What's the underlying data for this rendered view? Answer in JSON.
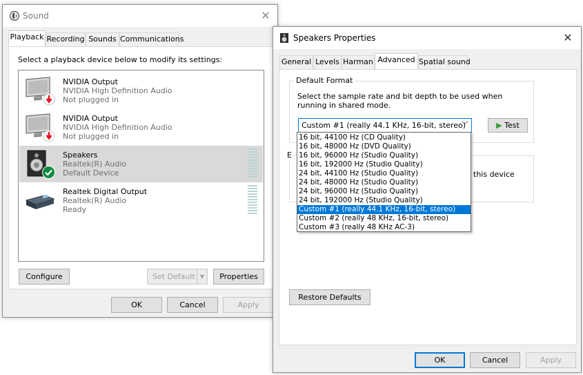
{
  "sound_window": {
    "title": "Sound",
    "tabs": [
      "Playback",
      "Recording",
      "Sounds",
      "Communications"
    ],
    "instruction": "Select a playback device below to modify its settings:",
    "devices": [
      {
        "name": "NVIDIA Output",
        "driver": "NVIDIA High Definition Audio",
        "status": "Not plugged in",
        "icon": "monitor-icon",
        "badge": "unplugged-arrow-icon"
      },
      {
        "name": "NVIDIA Output",
        "driver": "NVIDIA High Definition Audio",
        "status": "Not plugged in",
        "icon": "monitor-icon",
        "badge": "unplugged-arrow-icon"
      },
      {
        "name": "Speakers",
        "driver": "Realtek(R) Audio",
        "status": "Default Device",
        "icon": "speaker-icon",
        "badge": "default-check-icon",
        "selected": true
      },
      {
        "name": "Realtek Digital Output",
        "driver": "Realtek(R) Audio",
        "status": "Ready",
        "icon": "digital-output-icon"
      }
    ],
    "buttons": {
      "configure": "Configure",
      "set_default": "Set Default",
      "properties": "Properties",
      "ok": "OK",
      "cancel": "Cancel",
      "apply": "Apply"
    }
  },
  "props_window": {
    "title": "Speakers Properties",
    "tabs": [
      "General",
      "Levels",
      "Harman",
      "Advanced",
      "Spatial sound"
    ],
    "active_tab": "Advanced",
    "default_format": {
      "legend": "Default Format",
      "description": "Select the sample rate and bit depth to be used when running in shared mode.",
      "selected": "Custom #1 (really 44.1 KHz, 16-bit, stereo)",
      "test_label": "Test",
      "options": [
        "16 bit, 44100 Hz (CD Quality)",
        "16 bit, 48000 Hz (DVD Quality)",
        "16 bit, 96000 Hz (Studio Quality)",
        "16 bit, 192000 Hz (Studio Quality)",
        "24 bit, 44100 Hz (Studio Quality)",
        "24 bit, 48000 Hz (Studio Quality)",
        "24 bit, 96000 Hz (Studio Quality)",
        "24 bit, 192000 Hz (Studio Quality)",
        "Custom #1 (really 44.1 KHz, 16-bit, stereo)",
        "Custom #2 (really 48 KHz, 16-bit, stereo)",
        "Custom #3 (really 48 KHz AC-3)"
      ]
    },
    "exclusive_partial": {
      "legend_initial": "E",
      "text_fragment": "this device"
    },
    "restore_defaults": "Restore Defaults",
    "buttons": {
      "ok": "OK",
      "cancel": "Cancel",
      "apply": "Apply"
    }
  },
  "colors": {
    "accent": "#0078d7",
    "selection_gray": "#d9d9d9",
    "unplugged_red": "#e81123",
    "default_green": "#10893e",
    "test_green": "#3c9a3c"
  }
}
